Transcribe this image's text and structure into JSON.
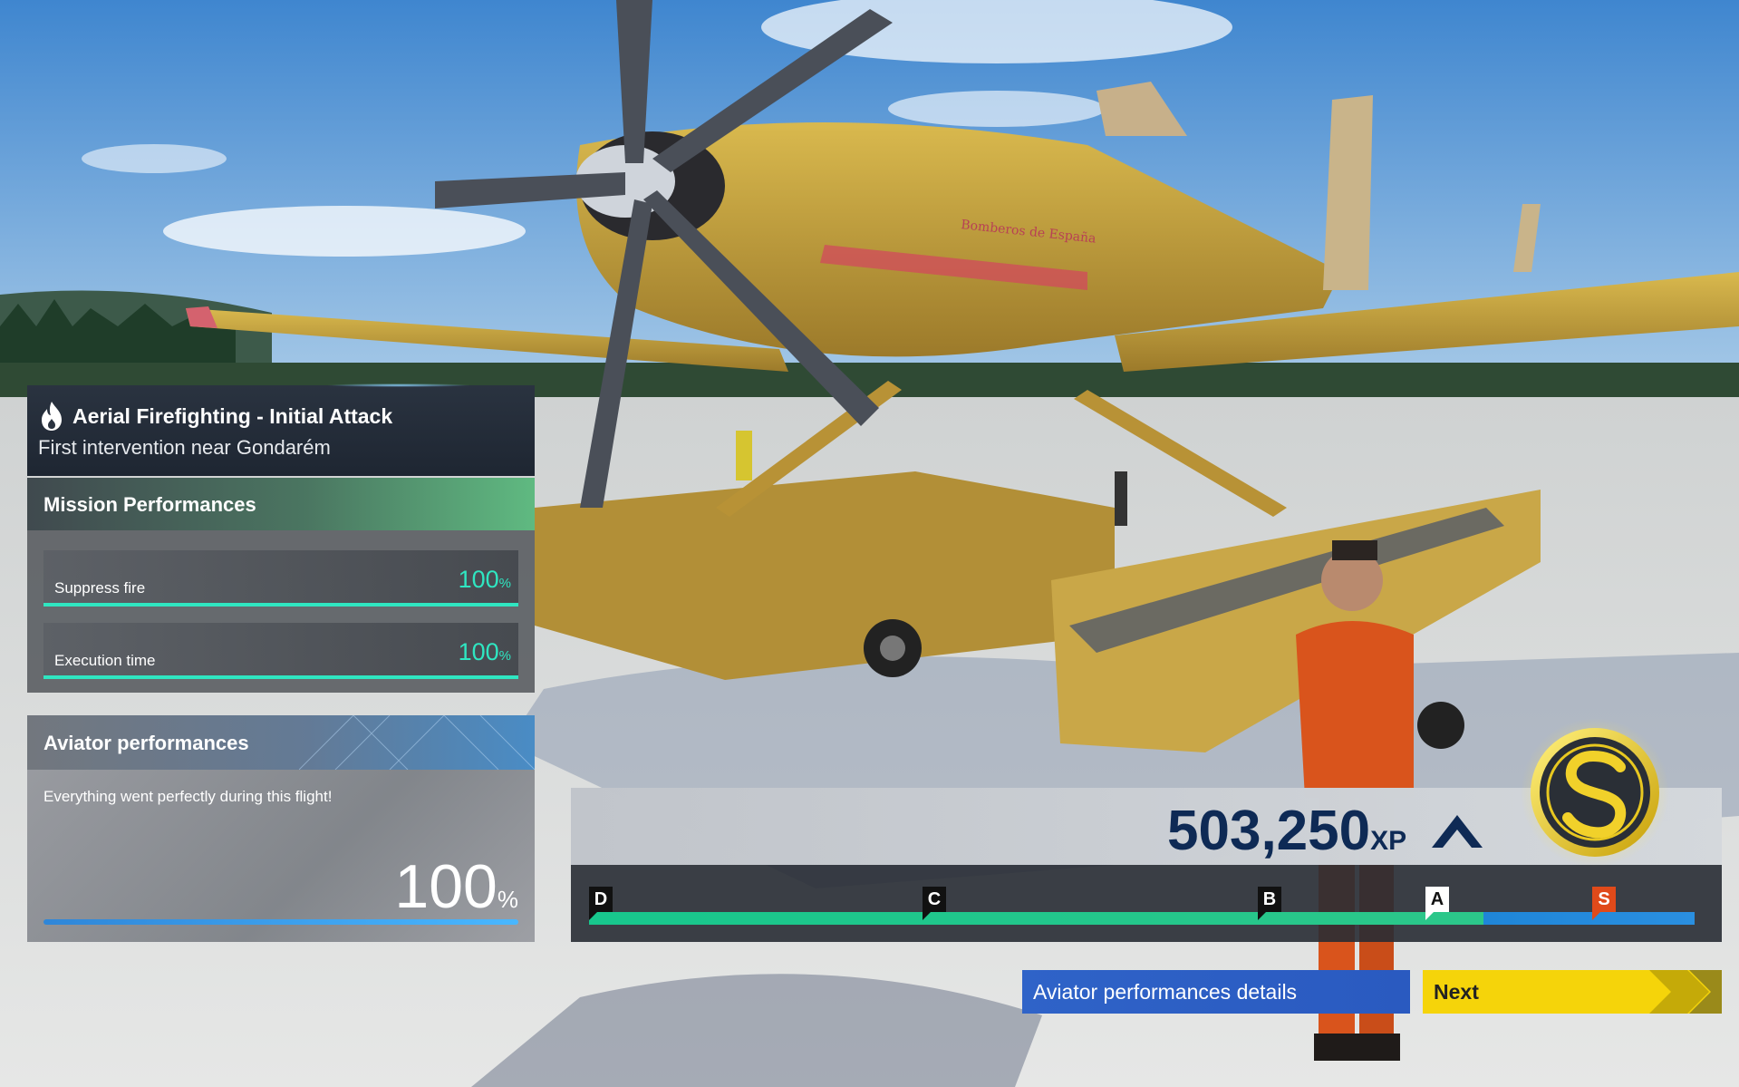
{
  "mission": {
    "title": "Aerial Firefighting - Initial Attack",
    "subtitle": "First intervention near Gondarém",
    "icon": "flame-icon"
  },
  "scene": {
    "aircraft_livery_text": "Bomberos de España"
  },
  "mission_performances": {
    "header": "Mission Performances",
    "items": [
      {
        "label": "Suppress fire",
        "value": "100",
        "unit": "%",
        "progress": 1.0
      },
      {
        "label": "Execution time",
        "value": "100",
        "unit": "%",
        "progress": 1.0
      }
    ]
  },
  "aviator_performances": {
    "header": "Aviator performances",
    "message": "Everything went perfectly during this flight!",
    "value": "100",
    "unit": "%",
    "progress": 1.0
  },
  "xp": {
    "value": "503,250",
    "unit": "XP",
    "trend_icon": "chevron-up-icon",
    "ranks": [
      "D",
      "C",
      "B",
      "A",
      "S"
    ],
    "rank_badge": "S"
  },
  "buttons": {
    "details_label": "Aviator performances details",
    "next_label": "Next"
  },
  "colors": {
    "accent_teal": "#2fe6c1",
    "xp_navy": "#0e2a55",
    "button_blue": "#2f63c8",
    "button_yellow": "#f5d40a",
    "rank_s": "#e04a1a",
    "badge_gold": "#e8c820"
  }
}
